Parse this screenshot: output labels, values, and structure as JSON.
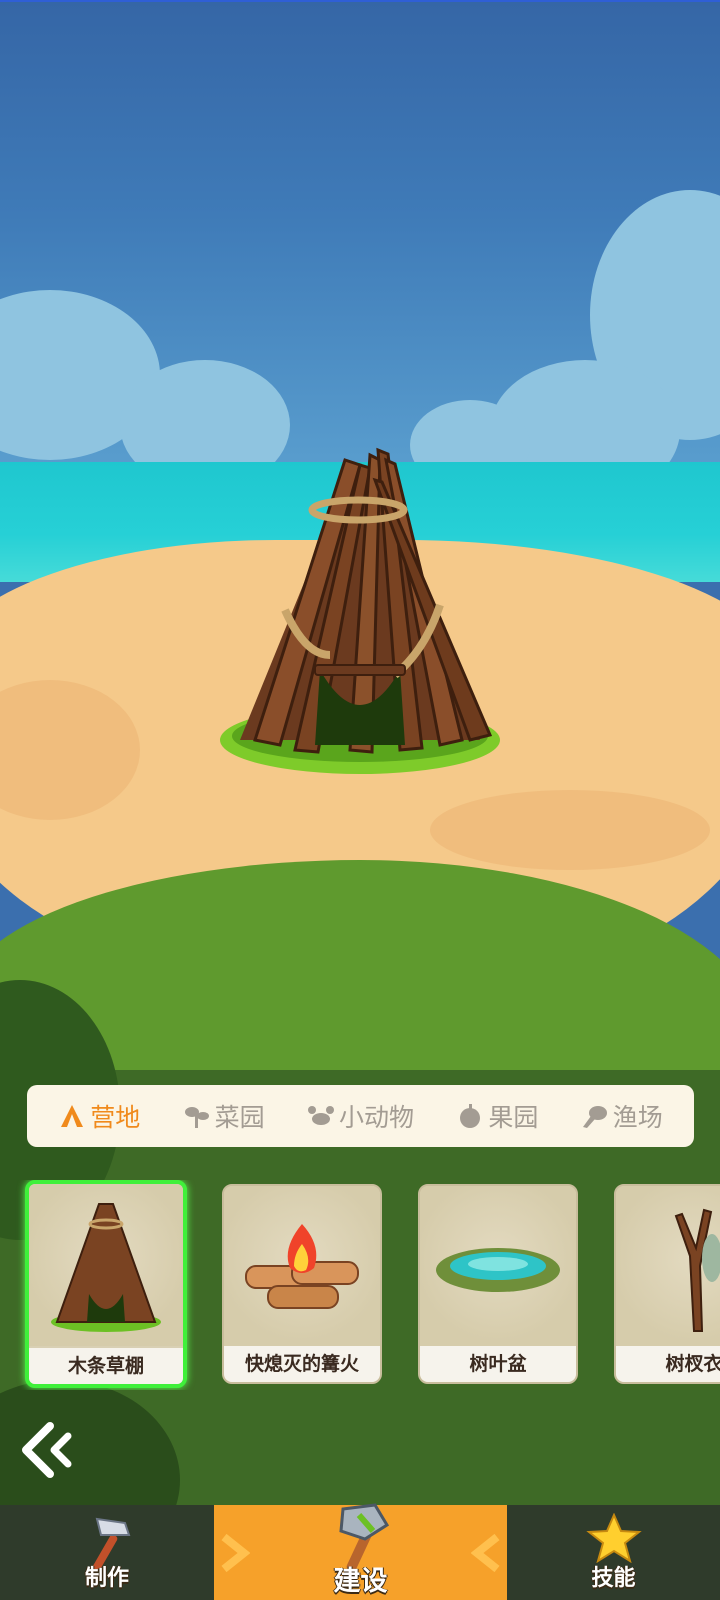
{
  "categories": {
    "items": [
      {
        "label": "营地",
        "icon": "tent-icon",
        "active": true
      },
      {
        "label": "菜园",
        "icon": "sprout-icon",
        "active": false
      },
      {
        "label": "小动物",
        "icon": "crab-icon",
        "active": false
      },
      {
        "label": "果园",
        "icon": "fruit-icon",
        "active": false
      },
      {
        "label": "渔场",
        "icon": "fish-icon",
        "active": false
      }
    ],
    "active_color": "#f08a1c",
    "inactive_color": "#a39c93"
  },
  "buildings": [
    {
      "name": "木条草棚",
      "icon": "wooden-hut-icon",
      "selected": true
    },
    {
      "name": "快熄灭的篝火",
      "icon": "campfire-icon",
      "selected": false
    },
    {
      "name": "树叶盆",
      "icon": "leaf-basin-icon",
      "selected": false
    },
    {
      "name": "树杈衣",
      "icon": "branch-rack-icon",
      "selected": false
    }
  ],
  "bottom_nav": {
    "items": [
      {
        "label": "制作",
        "icon": "hammer-icon",
        "active": false
      },
      {
        "label": "建设",
        "icon": "stone-axe-icon",
        "active": true
      },
      {
        "label": "技能",
        "icon": "star-icon",
        "active": false
      }
    ],
    "active_color": "#f6a12a"
  },
  "back": {
    "icon": "double-chevron-left-icon"
  }
}
